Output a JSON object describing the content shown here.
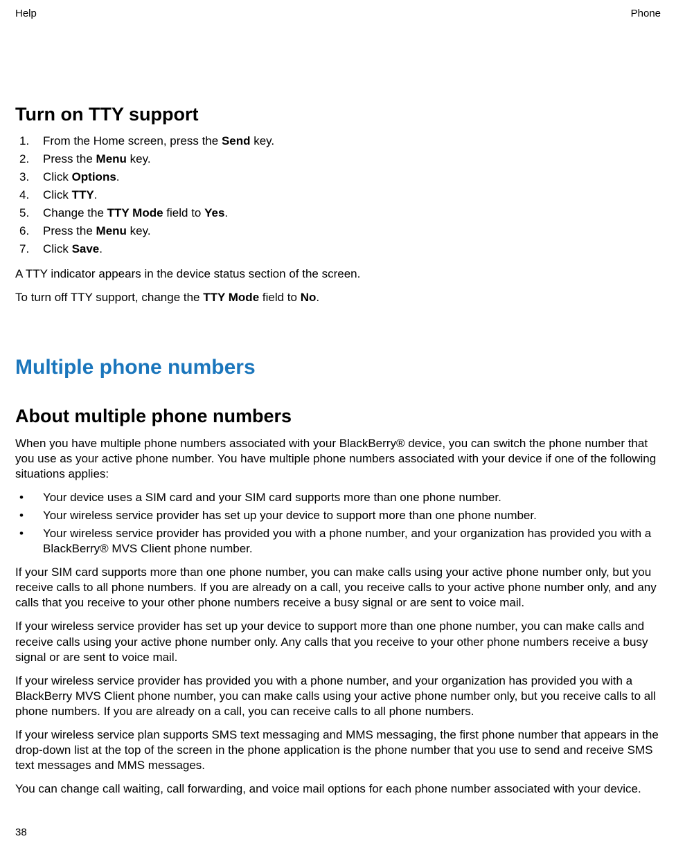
{
  "header": {
    "left": "Help",
    "right": "Phone"
  },
  "page_number": "38",
  "section1": {
    "title": "Turn on TTY support",
    "steps": [
      {
        "pre": "From the Home screen, press the ",
        "bold": "Send",
        "post": " key."
      },
      {
        "pre": "Press the ",
        "bold": "Menu",
        "post": " key."
      },
      {
        "pre": "Click ",
        "bold": "Options",
        "post": "."
      },
      {
        "pre": "Click ",
        "bold": "TTY",
        "post": "."
      },
      {
        "pre": "Change the ",
        "bold": "TTY Mode",
        "mid": " field to ",
        "bold2": "Yes",
        "post": "."
      },
      {
        "pre": "Press the ",
        "bold": "Menu",
        "post": " key."
      },
      {
        "pre": "Click ",
        "bold": "Save",
        "post": "."
      }
    ],
    "para1": "A TTY indicator appears in the device status section of the screen.",
    "para2_pre": "To turn off TTY support, change the ",
    "para2_b1": "TTY Mode",
    "para2_mid": " field to ",
    "para2_b2": "No",
    "para2_post": "."
  },
  "chapter": {
    "title": "Multiple phone numbers"
  },
  "section2": {
    "title": "About multiple phone numbers",
    "intro": "When you have multiple phone numbers associated with your BlackBerry® device, you can switch the phone number that you use as your active phone number. You have multiple phone numbers associated with your device if one of the following situations applies:",
    "bullets": [
      "Your device uses a SIM card and your SIM card supports more than one phone number.",
      "Your wireless service provider has set up your device to support more than one phone number.",
      "Your wireless service provider has provided you with a phone number, and your organization has provided you with a BlackBerry® MVS Client phone number."
    ],
    "p1": "If your SIM card supports more than one phone number, you can make calls using your active phone number only, but you receive calls to all phone numbers. If you are already on a call, you receive calls to your active phone number only, and any calls that you receive to your other phone numbers receive a busy signal or are sent to voice mail.",
    "p2": "If your wireless service provider has set up your device to support more than one phone number, you can make calls and receive calls using your active phone number only. Any calls that you receive to your other phone numbers receive a busy signal or are sent to voice mail.",
    "p3": "If your wireless service provider has provided you with a phone number, and your organization has provided you with a BlackBerry MVS Client phone number, you can make calls using your active phone number only, but you receive calls to all phone numbers. If you are already on a call, you can receive calls to all phone numbers.",
    "p4": "If your wireless service plan supports SMS text messaging and MMS messaging, the first phone number that appears in the drop-down list at the top of the screen in the phone application is the phone number that you use to send and receive SMS text messages and MMS messages.",
    "p5": "You can change call waiting, call forwarding, and voice mail options for each phone number associated with your device."
  }
}
